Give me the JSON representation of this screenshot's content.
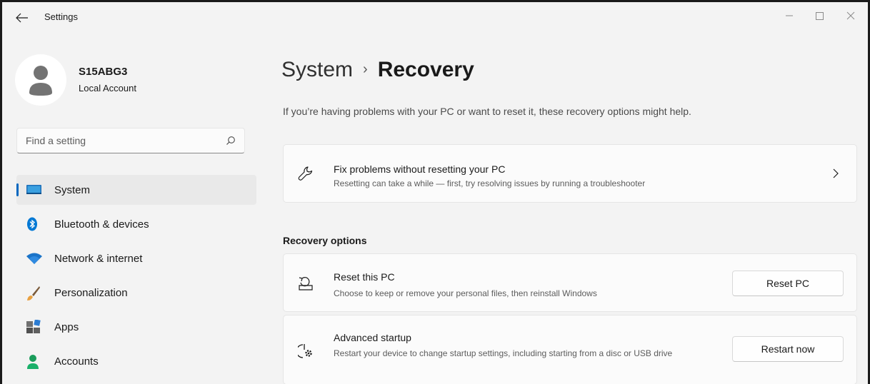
{
  "window": {
    "title": "Settings"
  },
  "profile": {
    "name": "S15ABG3",
    "account_type": "Local Account"
  },
  "search": {
    "placeholder": "Find a setting"
  },
  "sidebar": {
    "items": [
      {
        "label": "System",
        "icon": "system-display-icon",
        "active": true
      },
      {
        "label": "Bluetooth & devices",
        "icon": "bluetooth-icon",
        "active": false
      },
      {
        "label": "Network & internet",
        "icon": "wifi-icon",
        "active": false
      },
      {
        "label": "Personalization",
        "icon": "paintbrush-icon",
        "active": false
      },
      {
        "label": "Apps",
        "icon": "apps-icon",
        "active": false
      },
      {
        "label": "Accounts",
        "icon": "person-icon",
        "active": false
      }
    ]
  },
  "breadcrumb": {
    "parent": "System",
    "separator": "›",
    "current": "Recovery"
  },
  "intro": "If you’re having problems with your PC or want to reset it, these recovery options might help.",
  "fix_card": {
    "title": "Fix problems without resetting your PC",
    "description": "Resetting can take a while — first, try resolving issues by running a troubleshooter",
    "icon": "wrench-icon"
  },
  "recovery_section": {
    "heading": "Recovery options",
    "options": [
      {
        "title": "Reset this PC",
        "description": "Choose to keep or remove your personal files, then reinstall Windows",
        "button": "Reset PC",
        "icon": "reset-pc-icon"
      },
      {
        "title": "Advanced startup",
        "description": "Restart your device to change startup settings, including starting from a disc or USB drive",
        "button": "Restart now",
        "icon": "advanced-startup-icon"
      }
    ]
  },
  "colors": {
    "accent": "#0067c0",
    "window_bg": "#f3f3f3",
    "card_bg": "#fbfbfb",
    "active_nav_bg": "#e9e9e9"
  }
}
